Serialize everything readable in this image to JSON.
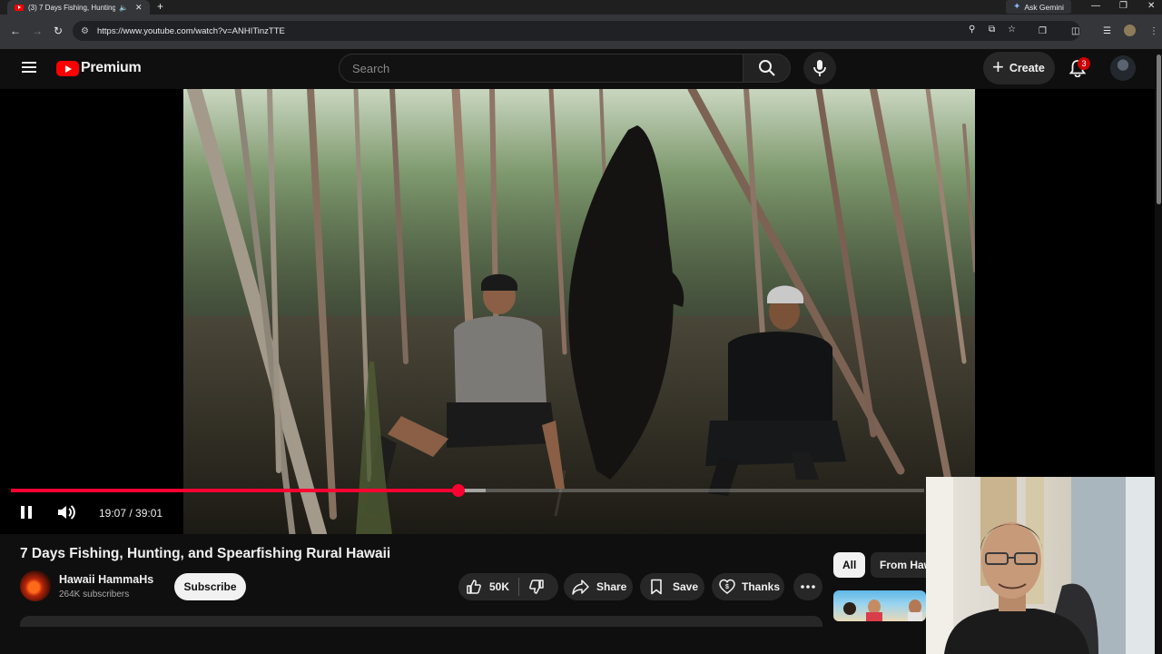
{
  "browser": {
    "tab_title": "(3) 7 Days Fishing, Hunting",
    "tab_audio_icon": "speaker-icon",
    "new_tab_symbol": "+",
    "gemini_label": "Ask Gemini",
    "url": "https://www.youtube.com/watch?v=ANHITinzTTE"
  },
  "header": {
    "brand": "Premium",
    "search_placeholder": "Search",
    "create_label": "Create",
    "notification_count": "3"
  },
  "player": {
    "time_current": "19:07",
    "time_separator": " / ",
    "time_total": "39:01",
    "progress_fraction": 0.49,
    "buffered_fraction": 0.52,
    "state": "playing"
  },
  "video": {
    "title": "7 Days Fishing, Hunting, and Spearfishing Rural Hawaii",
    "channel_name": "Hawaii HammaHs",
    "subscribers": "264K subscribers",
    "subscribe_label": "Subscribe",
    "like_count": "50K",
    "share_label": "Share",
    "save_label": "Save",
    "thanks_label": "Thanks"
  },
  "chips": [
    {
      "label": "All",
      "selected": true
    },
    {
      "label": "From Haw",
      "selected": false
    }
  ],
  "colors": {
    "accent_red": "#ff0033",
    "background": "#0f0f0f",
    "chip_selected": "#f1f1f1"
  }
}
